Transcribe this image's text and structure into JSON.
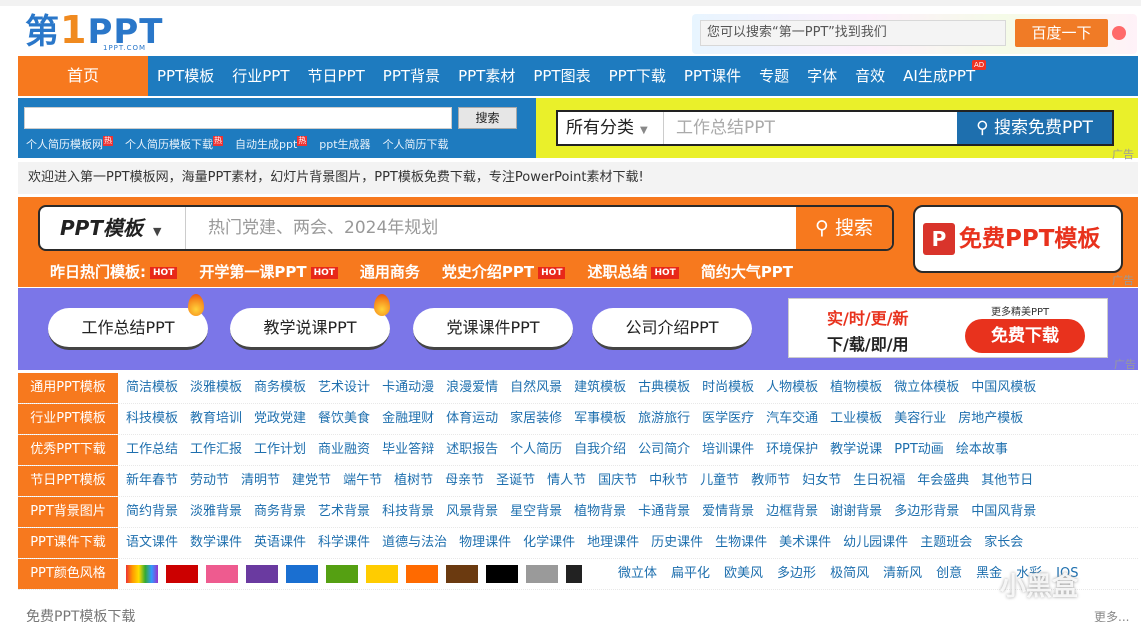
{
  "header": {
    "logo_text_a": "第",
    "logo_text_one": "1",
    "logo_text_b": "PPT",
    "logo_sub": "1PPT.COM",
    "search_placeholder": "您可以搜索“第一PPT”找到我们",
    "search_button": "百度一下"
  },
  "nav": {
    "home": "首页",
    "items": [
      "PPT模板",
      "行业PPT",
      "节日PPT",
      "PPT背景",
      "PPT素材",
      "PPT图表",
      "PPT下载",
      "PPT课件",
      "专题",
      "字体",
      "音效",
      "AI生成PPT"
    ],
    "ad_badge": "AD"
  },
  "left_search": {
    "button": "搜索",
    "links": [
      "个人简历模板网",
      "个人简历模板下载",
      "自动生成ppt",
      "ppt生成器",
      "个人简历下载"
    ],
    "hot_mini": "热"
  },
  "yellow_search": {
    "category": "所有分类",
    "placeholder": "工作总结PPT",
    "button": "搜索免费PPT"
  },
  "ad_label": "广告",
  "welcome": "欢迎进入第一PPT模板网，海量PPT素材，幻灯片背景图片，PPT模板免费下载，专注PowerPoint素材下载!",
  "orange_banner": {
    "category": "PPT模板",
    "placeholder": "热门党建、两会、2024年规划",
    "button": "搜索",
    "free_text": "免费PPT模板",
    "ppt_icon_letter": "P",
    "hot_prefix": "昨日热门模板:",
    "hot_tag": "HOT",
    "hot_items": [
      "开学第一课PPT",
      "通用商务",
      "党史介绍PPT",
      "述职总结",
      "简约大气PPT"
    ]
  },
  "pills": {
    "items": [
      "工作总结PPT",
      "教学说课PPT",
      "党课课件PPT",
      "公司介绍PPT"
    ],
    "promo_line1": "实/时/更/新",
    "promo_line2": "下/载/即/用",
    "promo_more": "更多精美PPT",
    "promo_button": "免费下载"
  },
  "categories": [
    {
      "label": "通用PPT模板",
      "links": [
        "简洁模板",
        "淡雅模板",
        "商务模板",
        "艺术设计",
        "卡通动漫",
        "浪漫爱情",
        "自然风景",
        "建筑模板",
        "古典模板",
        "时尚模板",
        "人物模板",
        "植物模板",
        "微立体模板",
        "中国风模板"
      ]
    },
    {
      "label": "行业PPT模板",
      "links": [
        "科技模板",
        "教育培训",
        "党政党建",
        "餐饮美食",
        "金融理财",
        "体育运动",
        "家居装修",
        "军事模板",
        "旅游旅行",
        "医学医疗",
        "汽车交通",
        "工业模板",
        "美容行业",
        "房地产模板"
      ]
    },
    {
      "label": "优秀PPT下载",
      "links": [
        "工作总结",
        "工作汇报",
        "工作计划",
        "商业融资",
        "毕业答辩",
        "述职报告",
        "个人简历",
        "自我介绍",
        "公司简介",
        "培训课件",
        "环境保护",
        "教学说课",
        "PPT动画",
        "绘本故事"
      ]
    },
    {
      "label": "节日PPT模板",
      "links": [
        "新年春节",
        "劳动节",
        "清明节",
        "建党节",
        "端午节",
        "植树节",
        "母亲节",
        "圣诞节",
        "情人节",
        "国庆节",
        "中秋节",
        "儿童节",
        "教师节",
        "妇女节",
        "生日祝福",
        "年会盛典",
        "其他节日"
      ]
    },
    {
      "label": "PPT背景图片",
      "links": [
        "简约背景",
        "淡雅背景",
        "商务背景",
        "艺术背景",
        "科技背景",
        "风景背景",
        "星空背景",
        "植物背景",
        "卡通背景",
        "爱情背景",
        "边框背景",
        "谢谢背景",
        "多边形背景",
        "中国风背景"
      ]
    },
    {
      "label": "PPT课件下载",
      "links": [
        "语文课件",
        "数学课件",
        "英语课件",
        "科学课件",
        "道德与法治",
        "物理课件",
        "化学课件",
        "地理课件",
        "历史课件",
        "生物课件",
        "美术课件",
        "幼儿园课件",
        "主题班会",
        "家长会"
      ]
    },
    {
      "label": "PPT颜色风格",
      "links": [
        "微立体",
        "扁平化",
        "欧美风",
        "多边形",
        "极简风",
        "清新风",
        "创意",
        "黑金",
        "水彩",
        "IOS"
      ]
    }
  ],
  "swatch_colors": [
    "#cc0000",
    "#ee5b8f",
    "#6a3aa0",
    "#1a6fd1",
    "#55a012",
    "#ffcc00",
    "#ff6a00",
    "#6b3a10",
    "#000000",
    "#9a9a9a",
    "#222222"
  ],
  "footer": {
    "title": "免费PPT模板下载",
    "more": "更多..."
  },
  "watermark": "小黑盒"
}
